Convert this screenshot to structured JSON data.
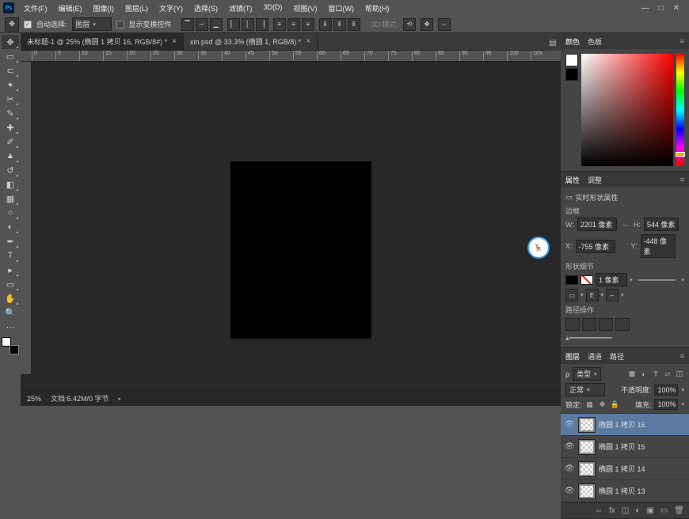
{
  "menu": [
    "文件(F)",
    "编辑(E)",
    "图像(I)",
    "图层(L)",
    "文字(Y)",
    "选择(S)",
    "滤镜(T)",
    "3D(D)",
    "视图(V)",
    "窗口(W)",
    "帮助(H)"
  ],
  "options": {
    "autoSelect": "自动选择:",
    "layerSel": "图层",
    "showControls": "显示变换控件",
    "mode": "3D 模式:"
  },
  "tabs": [
    {
      "label": "未标题-1 @ 25% (椭圆 1 拷贝 16, RGB/8#) *",
      "active": true
    },
    {
      "label": "xin.psd @ 33.3% (椭圆 1, RGB/8) *",
      "active": false
    }
  ],
  "rulerH": [
    "0",
    "5",
    "10",
    "15",
    "20",
    "25",
    "30",
    "35",
    "40",
    "45",
    "50",
    "55",
    "60",
    "65",
    "70",
    "75",
    "80",
    "85",
    "90",
    "95",
    "100",
    "105"
  ],
  "status": {
    "zoom": "25%",
    "doc": "文档:6.42M/0 字节"
  },
  "panels": {
    "color": {
      "tabs": [
        "颜色",
        "色板"
      ]
    },
    "properties": {
      "tabs": [
        "属性",
        "调整"
      ],
      "title": "实时形状属性",
      "boundsLabel": "边框",
      "w": "2201 像素",
      "h": "544 像素",
      "x": "-755 像素",
      "y": "-448 像素",
      "wL": "W:",
      "hL": "H:",
      "xL": "X:",
      "yL": "Y:",
      "shapeDetail": "形状细节",
      "strokeVal": "1 像素",
      "pathOps": "路径操作"
    },
    "layers": {
      "tabs": [
        "图层",
        "通道",
        "路径"
      ],
      "kind": "类型",
      "blend": "正常",
      "opacity": "不透明度:",
      "opVal": "100%",
      "lock": "锁定:",
      "fill": "填充:",
      "fillVal": "100%",
      "items": [
        {
          "name": "椭圆 1 拷贝 16",
          "selected": true
        },
        {
          "name": "椭圆 1 拷贝 15",
          "selected": false
        },
        {
          "name": "椭圆 1 拷贝 14",
          "selected": false
        },
        {
          "name": "椭圆 1 拷贝 13",
          "selected": false
        }
      ]
    }
  }
}
